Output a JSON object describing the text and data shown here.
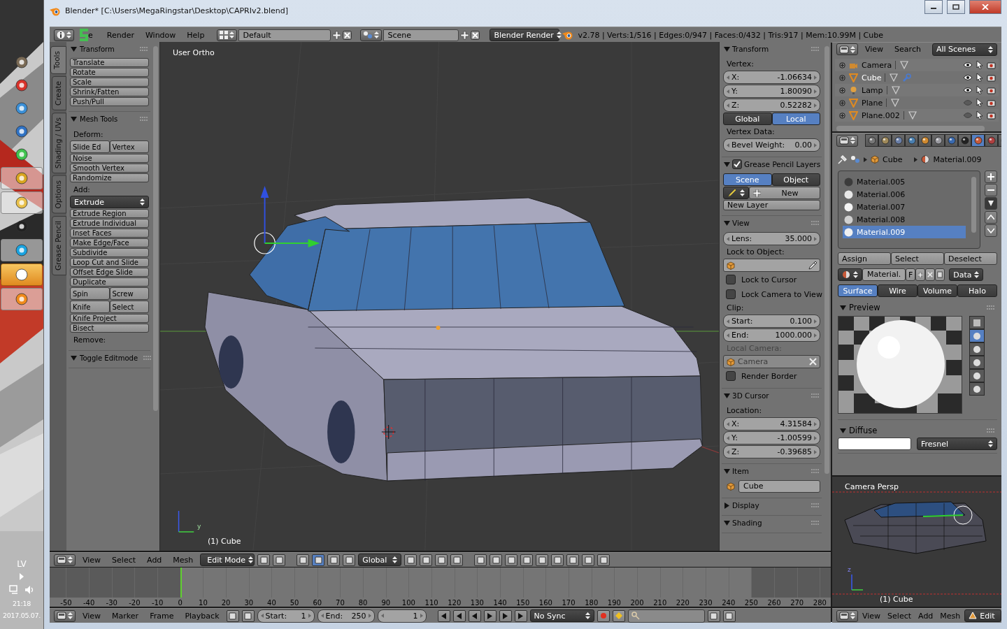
{
  "taskbar": {
    "apps": [
      {
        "kind": "gimp",
        "running": false,
        "selected": false
      },
      {
        "kind": "sketchup",
        "running": false,
        "selected": false
      },
      {
        "kind": "paint",
        "running": false,
        "selected": false
      },
      {
        "kind": "media",
        "running": false,
        "selected": false
      },
      {
        "kind": "whatsapp",
        "running": false,
        "selected": false
      },
      {
        "kind": "chrome",
        "running": true,
        "selected": false
      },
      {
        "kind": "folder",
        "running": true,
        "selected": false
      },
      {
        "kind": "inkscape",
        "running": false,
        "selected": false
      },
      {
        "kind": "skype",
        "running": true,
        "selected": false
      },
      {
        "kind": "share",
        "running": true,
        "selected": true
      },
      {
        "kind": "blender",
        "running": true,
        "selected": false
      }
    ],
    "language": "LV",
    "time": "21:18",
    "date": "2017.05.07."
  },
  "window": {
    "title": "Blender* [C:\\Users\\MegaRingstar\\Desktop\\CAPRIv2.blend]"
  },
  "info_header": {
    "menus": [
      "e",
      "Render",
      "Window",
      "Help"
    ],
    "layout": "Default",
    "scene": "Scene",
    "engine": "Blender Render",
    "stats": "v2.78 | Verts:1/516 | Edges:0/947 | Faces:0/432 | Tris:917 | Mem:10.99M | Cube"
  },
  "tool_shelf": {
    "tabs": [
      {
        "label": "Tools",
        "selected": true
      },
      {
        "label": "Create",
        "selected": false
      },
      {
        "label": "Shading / UVs",
        "selected": false
      },
      {
        "label": "Options",
        "selected": false
      },
      {
        "label": "Grease Pencil",
        "selected": false
      }
    ],
    "panels": [
      {
        "title": "Transform",
        "expanded": true,
        "rows": [
          {
            "kind": "button",
            "label": "Translate"
          },
          {
            "kind": "button",
            "label": "Rotate"
          },
          {
            "kind": "button",
            "label": "Scale"
          },
          {
            "kind": "button",
            "label": "Shrink/Fatten"
          },
          {
            "kind": "button",
            "label": "Push/Pull"
          }
        ]
      },
      {
        "title": "Mesh Tools",
        "expanded": true,
        "rows": [
          {
            "kind": "label",
            "text": "Deform:"
          },
          {
            "kind": "buttons",
            "labels": [
              "Slide Ed",
              "Vertex"
            ]
          },
          {
            "kind": "button",
            "label": "Noise"
          },
          {
            "kind": "button",
            "label": "Smooth Vertex"
          },
          {
            "kind": "button",
            "label": "Randomize"
          },
          {
            "kind": "label",
            "text": "Add:"
          },
          {
            "kind": "menu",
            "label": "Extrude"
          },
          {
            "kind": "button",
            "label": "Extrude Region"
          },
          {
            "kind": "button",
            "label": "Extrude Individual"
          },
          {
            "kind": "button",
            "label": "Inset Faces"
          },
          {
            "kind": "button",
            "label": "Make Edge/Face"
          },
          {
            "kind": "button",
            "label": "Subdivide"
          },
          {
            "kind": "button",
            "label": "Loop Cut and Slide"
          },
          {
            "kind": "button",
            "label": "Offset Edge Slide"
          },
          {
            "kind": "button",
            "label": "Duplicate"
          },
          {
            "kind": "buttons",
            "labels": [
              "Spin",
              "Screw"
            ]
          },
          {
            "kind": "buttons",
            "labels": [
              "Knife",
              "Select"
            ]
          },
          {
            "kind": "button",
            "label": "Knife Project"
          },
          {
            "kind": "button",
            "label": "Bisect"
          },
          {
            "kind": "label",
            "text": "Remove:"
          }
        ]
      },
      {
        "title": "Toggle Editmode",
        "expanded": true
      }
    ]
  },
  "viewport": {
    "view_name": "User Ortho",
    "object_info": "(1) Cube",
    "axis_label": "y"
  },
  "n_panel": {
    "panels": [
      {
        "title": "Transform",
        "expanded": true,
        "rows": [
          {
            "kind": "label",
            "text": "Vertex:"
          },
          {
            "kind": "number",
            "label": "X:",
            "value": "-1.06634"
          },
          {
            "kind": "number",
            "label": "Y:",
            "value": "1.80090"
          },
          {
            "kind": "number",
            "label": "Z:",
            "value": "0.52282"
          },
          {
            "kind": "toggle",
            "options": [
              {
                "label": "Global",
                "selected": false
              },
              {
                "label": "Local",
                "selected": true
              }
            ]
          },
          {
            "kind": "label",
            "text": "Vertex Data:"
          },
          {
            "kind": "number",
            "label": "Bevel Weight:",
            "value": "0.00"
          }
        ]
      },
      {
        "title": "Grease Pencil Layers",
        "expanded": true,
        "checked": true,
        "rows": [
          {
            "kind": "toggle",
            "options": [
              {
                "label": "Scene",
                "selected": true
              },
              {
                "label": "Object",
                "selected": false
              }
            ]
          },
          {
            "kind": "new",
            "label": "New"
          },
          {
            "kind": "button",
            "label": "New Layer"
          }
        ]
      },
      {
        "title": "View",
        "expanded": true,
        "rows": [
          {
            "kind": "number",
            "label": "Lens:",
            "value": "35.000"
          },
          {
            "kind": "label",
            "text": "Lock to Object:"
          },
          {
            "kind": "picker"
          },
          {
            "kind": "checkbox",
            "label": "Lock to Cursor",
            "checked": false
          },
          {
            "kind": "checkbox",
            "label": "Lock Camera to View",
            "checked": false
          },
          {
            "kind": "label",
            "text": "Clip:"
          },
          {
            "kind": "number",
            "label": "Start:",
            "value": "0.100"
          },
          {
            "kind": "number",
            "label": "End:",
            "value": "1000.000"
          },
          {
            "kind": "label",
            "text": "Local Camera:",
            "disabled": true
          },
          {
            "kind": "datablock",
            "value": "Camera",
            "disabled": true
          },
          {
            "kind": "checkbox",
            "label": "Render Border",
            "checked": false
          }
        ]
      },
      {
        "title": "3D Cursor",
        "expanded": true,
        "rows": [
          {
            "kind": "label",
            "text": "Location:"
          },
          {
            "kind": "number",
            "label": "X:",
            "value": "4.31584"
          },
          {
            "kind": "number",
            "label": "Y:",
            "value": "-1.00599"
          },
          {
            "kind": "number",
            "label": "Z:",
            "value": "-0.39685"
          }
        ]
      },
      {
        "title": "Item",
        "expanded": true,
        "rows": [
          {
            "kind": "name",
            "value": "Cube"
          }
        ]
      },
      {
        "title": "Display",
        "expanded": false
      },
      {
        "title": "Shading",
        "expanded": true
      }
    ]
  },
  "view3d_header": {
    "menus": [
      "View",
      "Select",
      "Add",
      "Mesh"
    ],
    "mode": "Edit Mode",
    "orientation": "Global",
    "manipulators": [
      {
        "selected": false
      },
      {
        "selected": true
      },
      {
        "selected": false
      },
      {
        "selected": false
      }
    ]
  },
  "timeline": {
    "ticks": [
      "-50",
      "-40",
      "-30",
      "-20",
      "-10",
      "0",
      "10",
      "20",
      "30",
      "40",
      "50",
      "60",
      "70",
      "80",
      "90",
      "100",
      "110",
      "120",
      "130",
      "140",
      "150",
      "160",
      "170",
      "180",
      "190",
      "200",
      "210",
      "220",
      "230",
      "240",
      "250",
      "260",
      "270",
      "280"
    ],
    "range_start": {
      "level": 0.167
    },
    "range_end": {
      "level": 0.898
    },
    "playhead": {
      "level": 0.167
    }
  },
  "timeline_header": {
    "menus": [
      "View",
      "Marker",
      "Frame",
      "Playback"
    ],
    "start_label": "Start:",
    "start": "1",
    "end_label": "End:",
    "end": "250",
    "current_frame": "1",
    "sync": "No Sync"
  },
  "outliner": {
    "menus": [
      "View",
      "Search"
    ],
    "filter": "All Scenes",
    "items": [
      {
        "name": "Camera",
        "kind": "camera",
        "selected": false,
        "visible": true,
        "modifier": false
      },
      {
        "name": "Cube",
        "kind": "mesh",
        "selected": true,
        "visible": true,
        "modifier": true
      },
      {
        "name": "Lamp",
        "kind": "lamp",
        "selected": false,
        "visible": true,
        "modifier": false
      },
      {
        "name": "Plane",
        "kind": "mesh",
        "selected": false,
        "visible": false,
        "modifier": false
      },
      {
        "name": "Plane.002",
        "kind": "mesh",
        "selected": false,
        "visible": false,
        "modifier": false
      }
    ]
  },
  "properties": {
    "tabs": [
      {
        "kind": "render",
        "selected": false
      },
      {
        "kind": "layers",
        "selected": false
      },
      {
        "kind": "scene",
        "selected": false
      },
      {
        "kind": "world",
        "selected": false
      },
      {
        "kind": "object",
        "selected": false
      },
      {
        "kind": "constraints",
        "selected": false
      },
      {
        "kind": "modifiers",
        "selected": false
      },
      {
        "kind": "data",
        "selected": false
      },
      {
        "kind": "material",
        "selected": true
      },
      {
        "kind": "texture",
        "selected": false
      },
      {
        "kind": "particles",
        "selected": false
      }
    ],
    "breadcrumb": [
      "Cube",
      "Material.009"
    ],
    "materials": [
      {
        "name": "Material.005",
        "color": "#3c3c3c",
        "selected": false
      },
      {
        "name": "Material.006",
        "color": "#e8e8e8",
        "selected": false
      },
      {
        "name": "Material.007",
        "color": "#f4f4f4",
        "selected": false
      },
      {
        "name": "Material.008",
        "color": "#d0d0d0",
        "selected": false
      },
      {
        "name": "Material.009",
        "color": "#f0f0f0",
        "selected": true
      }
    ],
    "slot_buttons": [
      "Assign",
      "Select",
      "Deselect"
    ],
    "datablock": {
      "name": "Material.",
      "fake_user": "F",
      "link": "Data"
    },
    "context_tabs": [
      {
        "label": "Surface",
        "selected": true
      },
      {
        "label": "Wire",
        "selected": false
      },
      {
        "label": "Volume",
        "selected": false
      },
      {
        "label": "Halo",
        "selected": false
      }
    ],
    "preview": {
      "title": "Preview",
      "expanded": true,
      "types": [
        {
          "selected": false
        },
        {
          "selected": true
        },
        {
          "selected": false
        },
        {
          "selected": false
        },
        {
          "selected": false
        },
        {
          "selected": false
        }
      ]
    },
    "diffuse": {
      "title": "Diffuse",
      "expanded": true,
      "color": "#ffffff",
      "shader": "Fresnel"
    }
  },
  "camera_view": {
    "label": "Camera Persp",
    "object_info": "(1) Cube",
    "axis_label": "z"
  },
  "camera_header": {
    "menus": [
      "View",
      "Select",
      "Add",
      "Mesh"
    ],
    "mode": "Edit"
  }
}
